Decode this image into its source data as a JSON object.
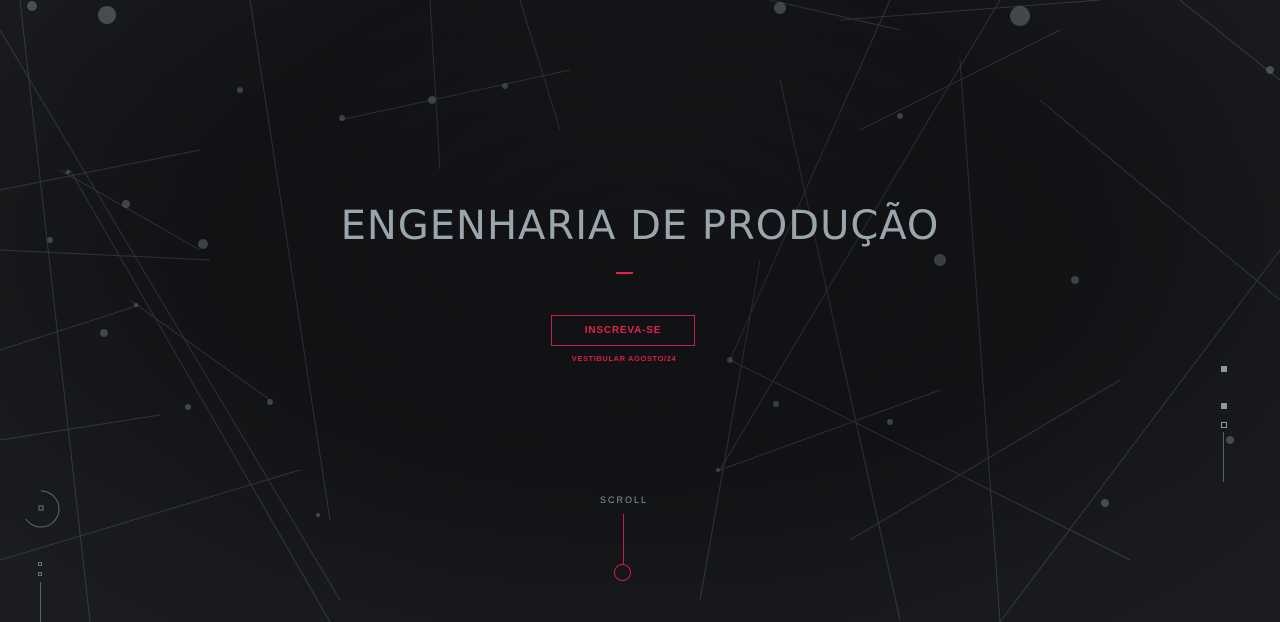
{
  "hero": {
    "title": "ENGENHARIA DE PRODUÇÃO",
    "cta_label": "INSCREVA-SE",
    "cta_subtitle": "VESTIBULAR AGOSTO/24"
  },
  "scroll": {
    "label": "SCROLL"
  },
  "side_nav": {
    "items": [
      {
        "icon": "filled-square-dot",
        "active": false
      },
      {
        "icon": "filled-square-dot",
        "active": false
      },
      {
        "icon": "hollow-square-dot",
        "active": true
      }
    ]
  },
  "colors": {
    "accent": "#e0234b",
    "title": "#9aa6ae",
    "background": "#16171a"
  }
}
